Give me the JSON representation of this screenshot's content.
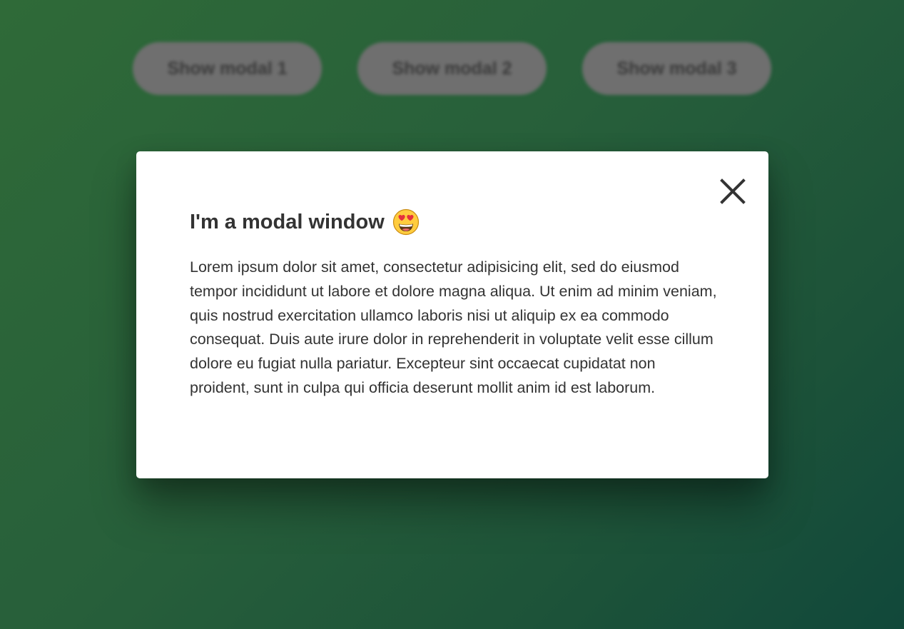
{
  "background_buttons": [
    {
      "label": "Show modal 1"
    },
    {
      "label": "Show modal 2"
    },
    {
      "label": "Show modal 3"
    }
  ],
  "modal": {
    "title": "I'm a modal window",
    "title_emoji_icon": "smiling-face-heart-eyes-icon",
    "close_icon": "close-icon",
    "body": "Lorem ipsum dolor sit amet, consectetur adipisicing elit, sed do eiusmod tempor incididunt ut labore et dolore magna aliqua. Ut enim ad minim veniam, quis nostrud exercitation ullamco laboris nisi ut aliquip ex ea commodo consequat. Duis aute irure dolor in reprehenderit in voluptate velit esse cillum dolore eu fugiat nulla pariatur. Excepteur sint occaecat cupidatat non proident, sunt in culpa qui officia deserunt mollit anim id est laborum."
  },
  "colors": {
    "background_gradient_start": "#2f6a38",
    "background_gradient_end": "#11483a",
    "button_bg": "#6f6f6f",
    "modal_bg": "#ffffff",
    "text": "#333333"
  }
}
